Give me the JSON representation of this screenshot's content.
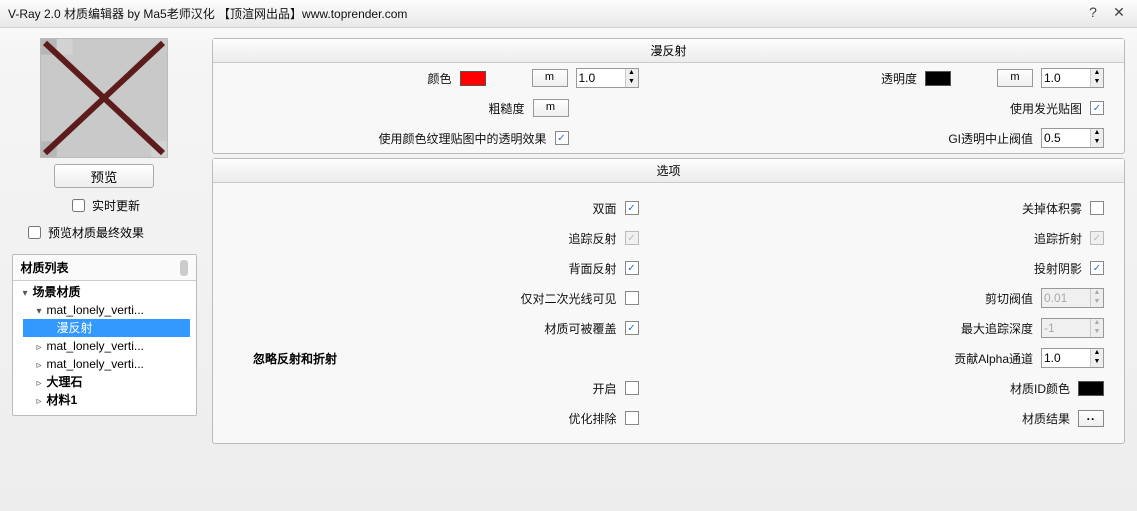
{
  "window": {
    "title": "V-Ray 2.0 材质编辑器 by Ma5老师汉化 【顶渲网出品】www.toprender.com"
  },
  "preview": {
    "button": "预览",
    "realtime_label": "实时更新",
    "realtime_checked": false,
    "final_label": "预览材质最终效果",
    "final_checked": false
  },
  "material_list": {
    "header": "材质列表",
    "root": "场景材质",
    "items": [
      {
        "label": "mat_lonely_verti...",
        "expanded": true
      },
      {
        "label": "漫反射",
        "selected": true,
        "indent": 2
      },
      {
        "label": "mat_lonely_verti..."
      },
      {
        "label": "mat_lonely_verti..."
      },
      {
        "label": "大理石"
      },
      {
        "label": "材料1"
      }
    ]
  },
  "diffuse": {
    "header": "漫反射",
    "color_label": "颜色",
    "color_hex": "#ff0000",
    "color_m": "m",
    "color_amount": "1.0",
    "roughness_label": "粗糙度",
    "roughness_m": "m",
    "use_color_tex_alpha_label": "使用颜色纹理贴图中的透明效果",
    "use_color_tex_alpha_checked": true,
    "transparency_label": "透明度",
    "transparency_hex": "#000000",
    "transparency_m": "m",
    "transparency_amount": "1.0",
    "use_emit_label": "使用发光贴图",
    "use_emit_checked": true,
    "gi_threshold_label": "GI透明中止阀值",
    "gi_threshold_value": "0.5"
  },
  "options": {
    "header": "选项",
    "double_sided_label": "双面",
    "double_sided_checked": true,
    "trace_reflect_label": "追踪反射",
    "trace_reflect_checked": true,
    "trace_reflect_disabled": true,
    "back_reflect_label": "背面反射",
    "back_reflect_checked": true,
    "only_secondary_label": "仅对二次光线可见",
    "only_secondary_checked": false,
    "overridable_label": "材质可被覆盖",
    "overridable_checked": true,
    "ignore_header": "忽略反射和折射",
    "enable_label": "开启",
    "enable_checked": false,
    "optimize_label": "优化排除",
    "optimize_checked": false,
    "disable_fog_label": "关掉体积雾",
    "disable_fog_checked": false,
    "trace_refract_label": "追踪折射",
    "trace_refract_checked": true,
    "trace_refract_disabled": true,
    "cast_shadow_label": "投射阴影",
    "cast_shadow_checked": true,
    "cutoff_label": "剪切阀值",
    "cutoff_value": "0.01",
    "cutoff_disabled": true,
    "max_depth_label": "最大追踪深度",
    "max_depth_value": "-1",
    "max_depth_disabled": true,
    "alpha_label": "贡献Alpha通道",
    "alpha_value": "1.0",
    "id_color_label": "材质ID颜色",
    "id_color_hex": "#000000",
    "result_label": "材质结果",
    "result_btn": ".."
  }
}
